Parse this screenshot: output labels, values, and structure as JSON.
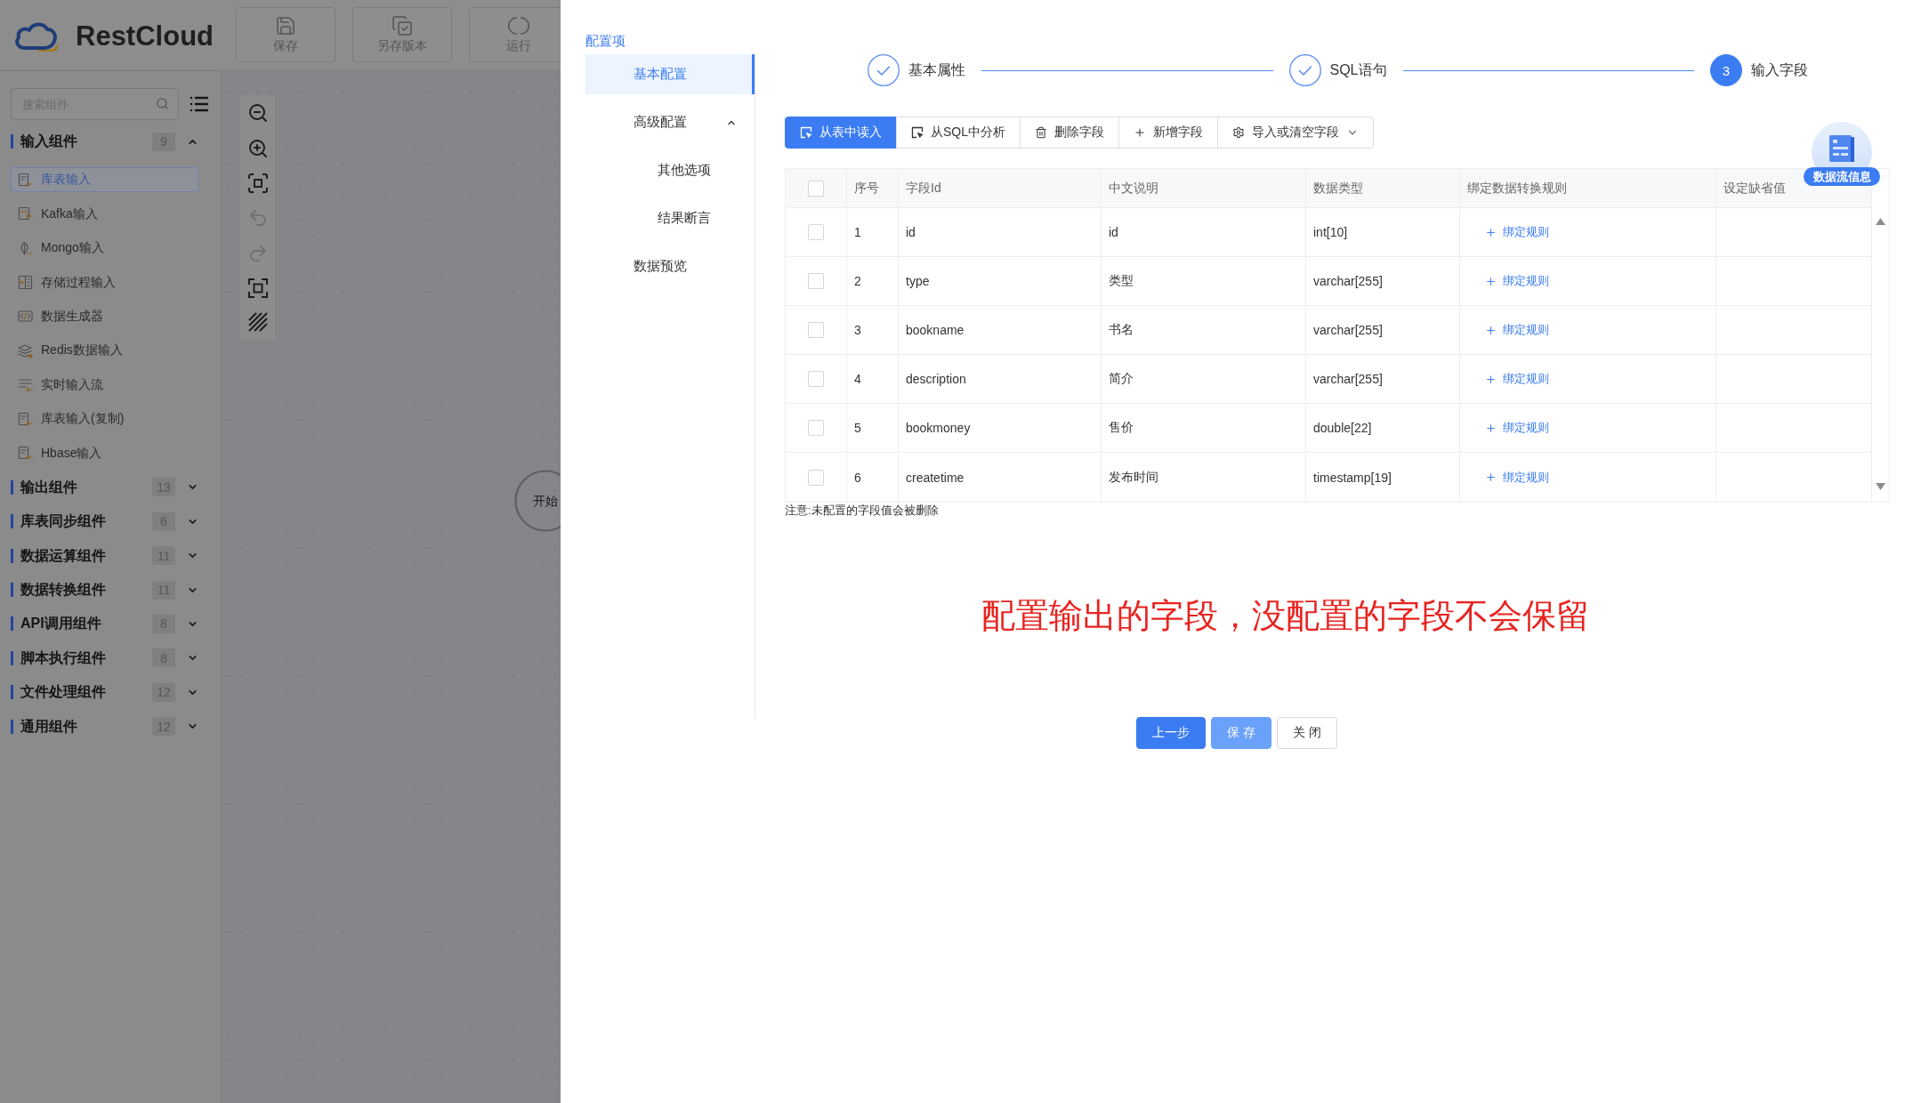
{
  "app_header": {
    "logo_text": "RestCloud",
    "actions": [
      {
        "label": "保存",
        "kind": "save"
      },
      {
        "label": "另存版本",
        "kind": "version"
      },
      {
        "label": "运行",
        "kind": "run"
      }
    ]
  },
  "component_panel": {
    "search": {
      "placeholder": "搜索组件"
    },
    "groups": [
      {
        "name": "输入组件",
        "count": "9",
        "expanded": true,
        "items": [
          {
            "label": "库表输入",
            "kind": "table",
            "selected": true
          },
          {
            "label": "Kafka输入",
            "kind": "kafka",
            "selected": false
          },
          {
            "label": "Mongo输入",
            "kind": "mongo",
            "selected": false
          },
          {
            "label": "存储过程输入",
            "kind": "procedure",
            "selected": false
          },
          {
            "label": "数据生成器",
            "kind": "generator",
            "selected": false
          },
          {
            "label": "Redis数据输入",
            "kind": "redis",
            "selected": false
          },
          {
            "label": "实时输入流",
            "kind": "stream",
            "selected": false
          },
          {
            "label": "库表输入(复制)",
            "kind": "table",
            "selected": false
          },
          {
            "label": "Hbase输入",
            "kind": "table",
            "selected": false
          }
        ]
      },
      {
        "name": "输出组件",
        "count": "13",
        "expanded": false
      },
      {
        "name": "库表同步组件",
        "count": "6",
        "expanded": false
      },
      {
        "name": "数据运算组件",
        "count": "11",
        "expanded": false
      },
      {
        "name": "数据转换组件",
        "count": "11",
        "expanded": false
      },
      {
        "name": "API调用组件",
        "count": "8",
        "expanded": false
      },
      {
        "name": "脚本执行组件",
        "count": "8",
        "expanded": false
      },
      {
        "name": "文件处理组件",
        "count": "12",
        "expanded": false
      },
      {
        "name": "通用组件",
        "count": "12",
        "expanded": false
      }
    ]
  },
  "canvas": {
    "tools": [
      {
        "kind": "zoom_out",
        "disabled": false
      },
      {
        "kind": "zoom_in",
        "disabled": false
      },
      {
        "kind": "fit",
        "disabled": false
      },
      {
        "kind": "undo",
        "disabled": true
      },
      {
        "kind": "redo",
        "disabled": true
      },
      {
        "kind": "center",
        "disabled": false
      },
      {
        "kind": "grid",
        "disabled": false
      }
    ],
    "nodes": [
      {
        "label": "开始"
      }
    ]
  },
  "config_menu": {
    "title": "配置项",
    "items": [
      {
        "label": "基本配置",
        "selected": true
      },
      {
        "label": "高级配置",
        "selected": false,
        "expanded": true,
        "children": [
          {
            "label": "其他选项",
            "selected": false
          },
          {
            "label": "结果断言",
            "selected": false
          }
        ]
      },
      {
        "label": "数据预览",
        "selected": false
      }
    ]
  },
  "steps": [
    {
      "label": "基本属性",
      "completed": true,
      "selected": false
    },
    {
      "label": "SQL语句",
      "completed": true,
      "selected": false
    },
    {
      "label": "输入字段",
      "completed": false,
      "selected": true,
      "number": "3"
    }
  ],
  "field_toolbar": [
    {
      "label": "从表中读入",
      "kind": "read",
      "primary": true
    },
    {
      "label": "从SQL中分析",
      "kind": "analyze",
      "primary": false
    },
    {
      "label": "删除字段",
      "kind": "delete",
      "primary": false
    },
    {
      "label": "新增字段",
      "kind": "add",
      "primary": false
    },
    {
      "label": "导入或清空字段",
      "kind": "import",
      "primary": false
    }
  ],
  "flow_info": {
    "label": "数据流信息"
  },
  "fields_table": {
    "select_all": {
      "checked": false
    },
    "columns": [
      "序号",
      "字段Id",
      "中文说明",
      "数据类型",
      "绑定数据转换规则",
      "设定缺省值"
    ],
    "rows": [
      {
        "checked": false,
        "no": "1",
        "field_id": "id",
        "chinese_desc": "id",
        "data_type": "int[10]",
        "rule": "绑定规则"
      },
      {
        "checked": false,
        "no": "2",
        "field_id": "type",
        "chinese_desc": "类型",
        "data_type": "varchar[255]",
        "rule": "绑定规则"
      },
      {
        "checked": false,
        "no": "3",
        "field_id": "bookname",
        "chinese_desc": "书名",
        "data_type": "varchar[255]",
        "rule": "绑定规则"
      },
      {
        "checked": false,
        "no": "4",
        "field_id": "description",
        "chinese_desc": "简介",
        "data_type": "varchar[255]",
        "rule": "绑定规则"
      },
      {
        "checked": false,
        "no": "5",
        "field_id": "bookmoney",
        "chinese_desc": "售价",
        "data_type": "double[22]",
        "rule": "绑定规则"
      },
      {
        "checked": false,
        "no": "6",
        "field_id": "createtime",
        "chinese_desc": "发布时间",
        "data_type": "timestamp[19]",
        "rule": "绑定规则"
      }
    ]
  },
  "note": "注意:未配置的字段值会被删除",
  "annotation": "配置输出的字段，没配置的字段不会保留",
  "footer_buttons": [
    {
      "label": "上一步",
      "kind": "primary"
    },
    {
      "label": "保 存",
      "kind": "light"
    },
    {
      "label": "关 闭",
      "kind": "default"
    }
  ]
}
